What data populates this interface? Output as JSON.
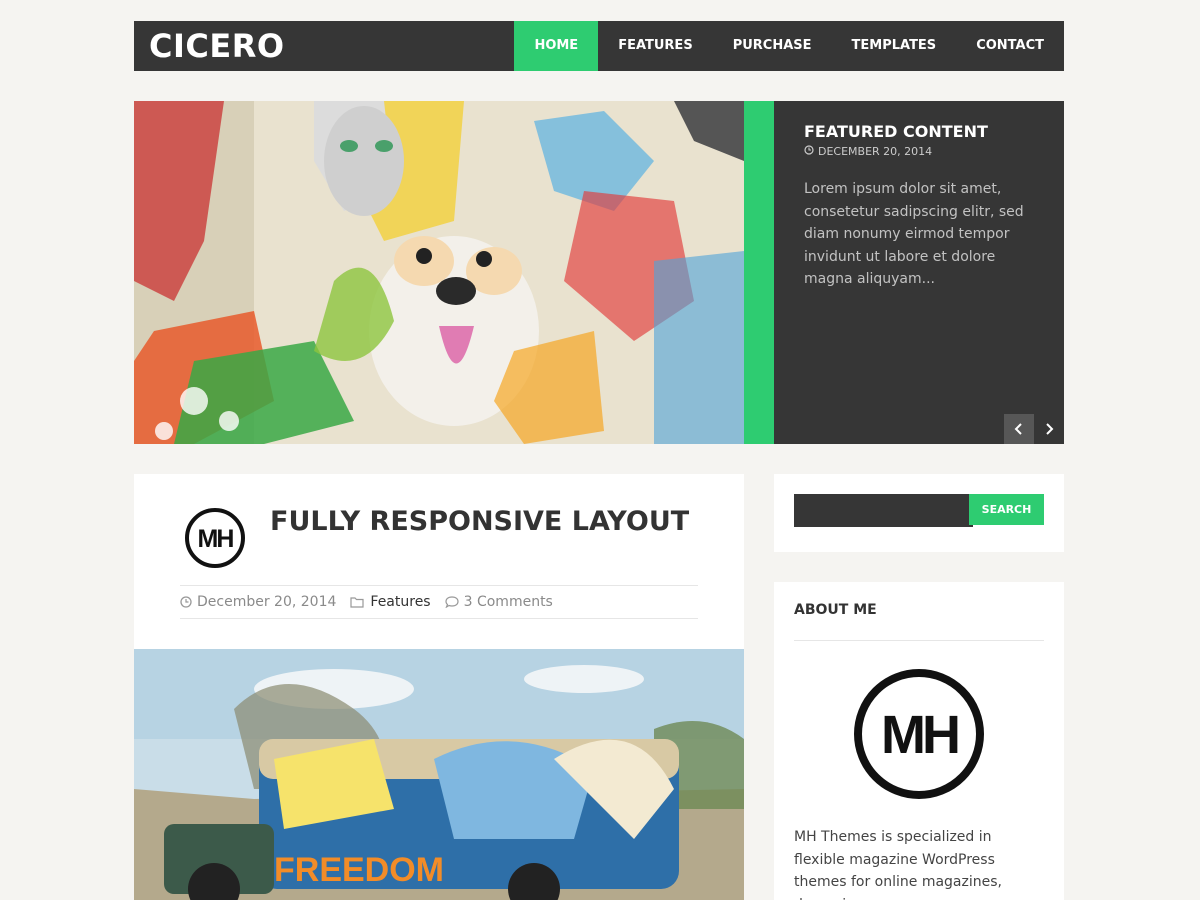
{
  "site": {
    "title": "CICERO"
  },
  "nav": {
    "items": [
      {
        "label": "HOME"
      },
      {
        "label": "FEATURES"
      },
      {
        "label": "PURCHASE"
      },
      {
        "label": "TEMPLATES"
      },
      {
        "label": "CONTACT"
      }
    ],
    "active": "HOME"
  },
  "slider": {
    "title": "FEATURED CONTENT",
    "date": "DECEMBER 20, 2014",
    "excerpt": "Lorem ipsum dolor sit amet, consetetur sadipscing elitr, sed diam nonumy eirmod tempor invidunt ut labore et dolore magna aliquyam..."
  },
  "post": {
    "title": "FULLY RESPONSIVE LAYOUT",
    "logo_text": "MH",
    "date": "December 20, 2014",
    "category": "Features",
    "comments": "3 Comments"
  },
  "sidebar": {
    "search_button": "SEARCH",
    "about_title": "ABOUT ME",
    "about_logo_text": "MH",
    "about_text": "MH Themes is specialized in flexible magazine WordPress themes for online magazines, dynamic news"
  },
  "colors": {
    "accent": "#2ecc71",
    "dark": "#363636",
    "background": "#f5f4f1"
  }
}
